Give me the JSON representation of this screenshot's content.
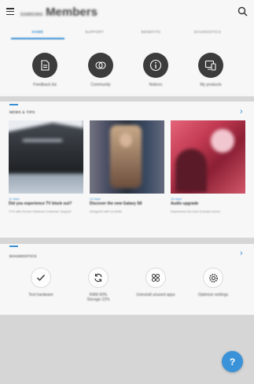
{
  "header": {
    "brand_small": "SAMSUNG",
    "brand_big": "Members"
  },
  "tabs": [
    {
      "label": "HOME",
      "active": true
    },
    {
      "label": "SUPPORT",
      "active": false
    },
    {
      "label": "BENEFITS",
      "active": false
    },
    {
      "label": "DIAGNOSTICS",
      "active": false
    }
  ],
  "quick_actions": [
    {
      "label": "Feedback list",
      "icon": "document-icon"
    },
    {
      "label": "Community",
      "icon": "community-icon"
    },
    {
      "label": "Notices",
      "icon": "info-icon"
    },
    {
      "label": "My products",
      "icon": "devices-icon"
    }
  ],
  "news": {
    "title": "NEWS & TIPS",
    "cards": [
      {
        "tag": "11 days",
        "title": "Did you experience TV block out?",
        "sub": "TV's with Screen blackout Customer Support"
      },
      {
        "tag": "14 days",
        "title": "Discover the new Galaxy S8",
        "sub": "Designed with no limits"
      },
      {
        "tag": "18 days",
        "title": "Audio upgrade",
        "sub": "Experience the best of audio sound"
      }
    ]
  },
  "diagnostics": {
    "title": "DIAGNOSTICS",
    "items": [
      {
        "label": "Test hardware",
        "icon": "check-icon"
      },
      {
        "label": "RAM 60%\nStorage 22%",
        "icon": "refresh-icon"
      },
      {
        "label": "Uninstall unused apps",
        "icon": "apps-grid-icon"
      },
      {
        "label": "Optimize settings",
        "icon": "settings-gear-icon"
      }
    ]
  },
  "help": {
    "label": "?"
  },
  "colors": {
    "accent": "#3a8fd4",
    "fab": "#3a93d8",
    "icon_circle": "#3c3c3c"
  }
}
